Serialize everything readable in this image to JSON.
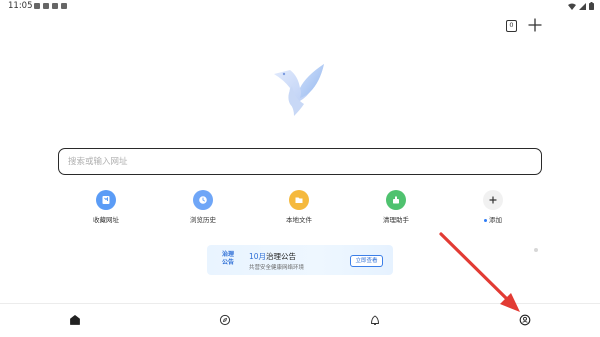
{
  "status_bar": {
    "time": "11:05"
  },
  "toolbar": {
    "tab_count": "0"
  },
  "search": {
    "placeholder": "搜索或输入网址",
    "value": ""
  },
  "shortcuts": [
    {
      "label": "收藏网址",
      "icon": "bookmark-icon",
      "color": "#5b9cf6"
    },
    {
      "label": "浏览历史",
      "icon": "clock-icon",
      "color": "#6fa6f7"
    },
    {
      "label": "本地文件",
      "icon": "folder-icon",
      "color": "#f5b93d"
    },
    {
      "label": "清理助手",
      "icon": "broom-icon",
      "color": "#4fc26f"
    },
    {
      "label": "添加",
      "icon": "plus-icon",
      "color": "#f1f1f1"
    }
  ],
  "banner": {
    "badge_line1": "治理",
    "badge_line2": "公告",
    "title_accent": "10月",
    "title_rest": "治理公告",
    "subtitle": "共营安全健康网络环境",
    "button_label": "立即查看"
  },
  "bottom_nav": [
    {
      "name": "home",
      "icon": "home-icon"
    },
    {
      "name": "discover",
      "icon": "compass-icon"
    },
    {
      "name": "feed",
      "icon": "bell-icon"
    },
    {
      "name": "profile",
      "icon": "user-icon"
    }
  ],
  "colors": {
    "accent": "#2f6fd6",
    "annotation_arrow": "#e23b34"
  }
}
